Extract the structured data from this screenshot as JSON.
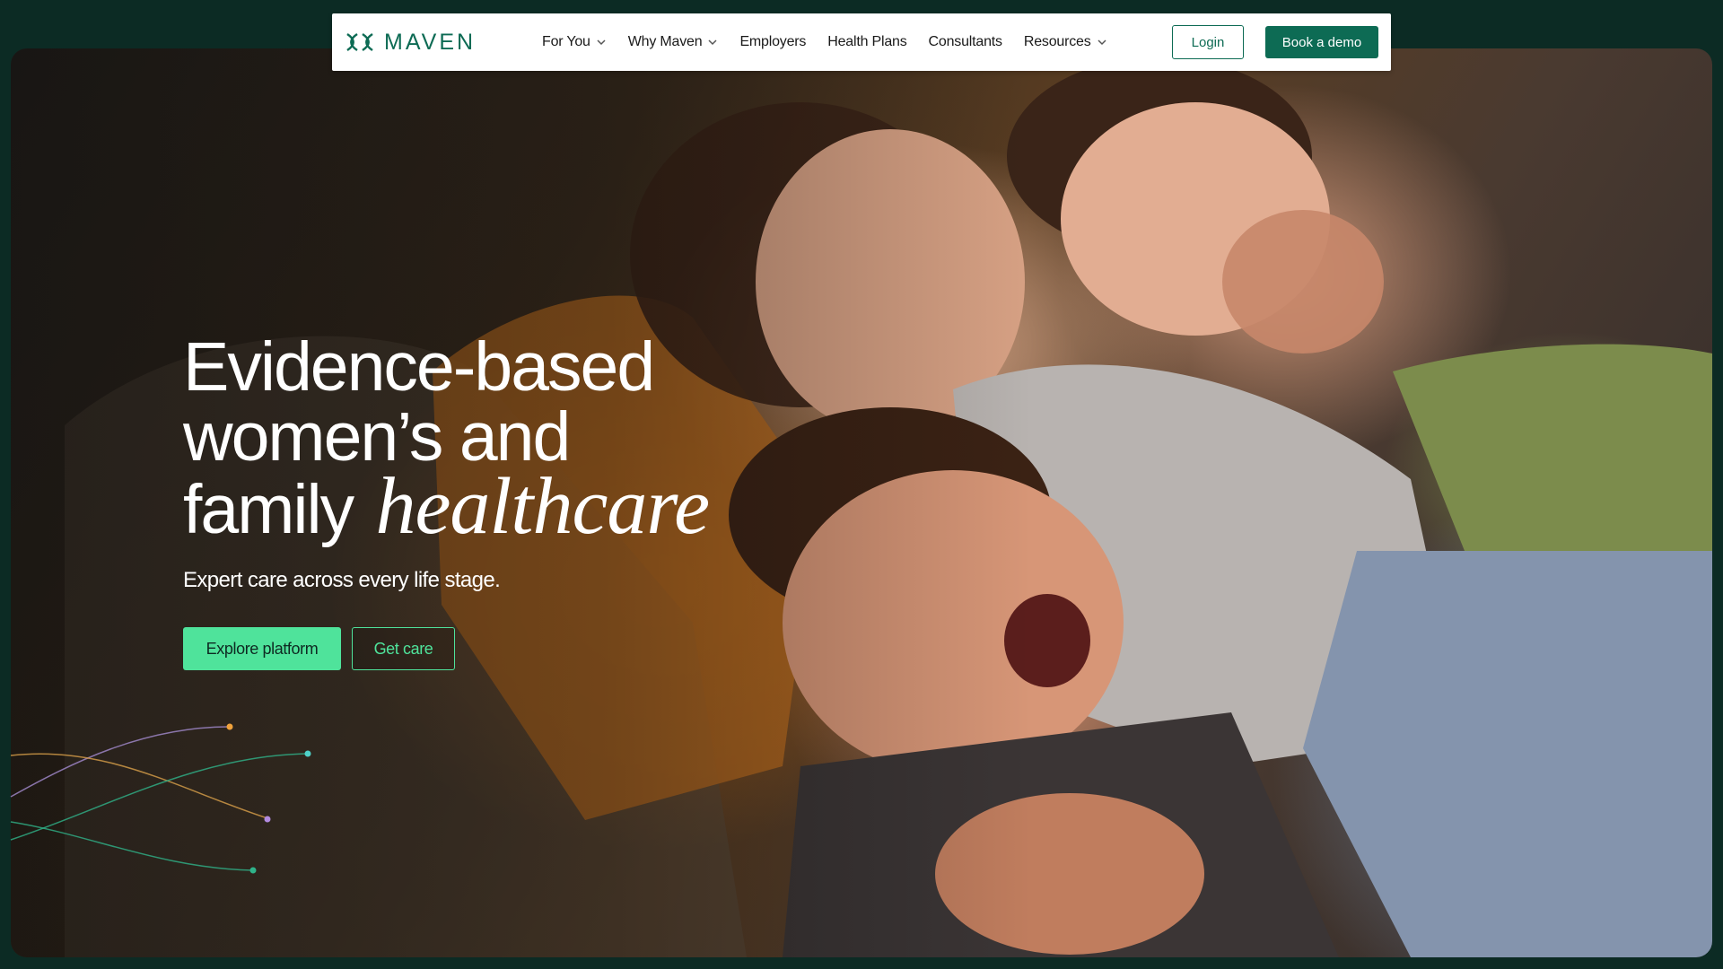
{
  "nav": {
    "logo_text": "MAVEN",
    "items": [
      {
        "label": "For You",
        "has_dropdown": true
      },
      {
        "label": "Why Maven",
        "has_dropdown": true
      },
      {
        "label": "Employers",
        "has_dropdown": false
      },
      {
        "label": "Health Plans",
        "has_dropdown": false
      },
      {
        "label": "Consultants",
        "has_dropdown": false
      },
      {
        "label": "Resources",
        "has_dropdown": true
      }
    ],
    "login_label": "Login",
    "demo_label": "Book a demo"
  },
  "hero": {
    "headline_line1": "Evidence-based",
    "headline_line2": "women’s and",
    "headline_line3_plain": "family",
    "headline_line3_italic": "healthcare",
    "subhead": "Expert care across every life stage.",
    "primary_cta": "Explore platform",
    "secondary_cta": "Get care"
  },
  "colors": {
    "brand_green": "#0d6b54",
    "accent_mint": "#4fe39b",
    "page_bg": "#0c2b24"
  }
}
